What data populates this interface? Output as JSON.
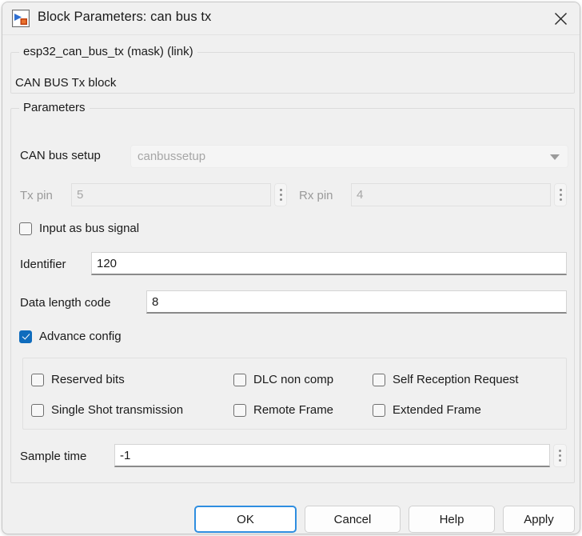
{
  "window": {
    "title": "Block Parameters: can bus tx",
    "icon": "simulink-block-icon",
    "close_label": "✕"
  },
  "mask_group": {
    "legend": "esp32_can_bus_tx (mask) (link)",
    "description": "CAN BUS Tx block"
  },
  "parameters_group": {
    "legend": "Parameters",
    "can_bus_setup": {
      "label": "CAN bus setup",
      "value": "canbussetup",
      "enabled": false
    },
    "tx_pin": {
      "label": "Tx pin",
      "value": "5",
      "enabled": false
    },
    "rx_pin": {
      "label": "Rx pin",
      "value": "4",
      "enabled": false
    },
    "input_as_bus_signal": {
      "label": "Input as bus signal",
      "checked": false
    },
    "identifier": {
      "label": "Identifier",
      "value": "120"
    },
    "data_length_code": {
      "label": "Data length code",
      "value": "8"
    },
    "advance_config": {
      "label": "Advance config",
      "checked": true
    },
    "advance_options": [
      {
        "label": "Reserved bits",
        "checked": false
      },
      {
        "label": "DLC non comp",
        "checked": false
      },
      {
        "label": "Self Reception Request",
        "checked": false
      },
      {
        "label": "Single Shot transmission",
        "checked": false
      },
      {
        "label": "Remote Frame",
        "checked": false
      },
      {
        "label": "Extended Frame",
        "checked": false
      }
    ],
    "sample_time": {
      "label": "Sample time",
      "value": "-1"
    }
  },
  "footer": {
    "ok": "OK",
    "cancel": "Cancel",
    "help": "Help",
    "apply": "Apply"
  },
  "colors": {
    "accent": "#0f6cbd",
    "focus_border": "#2f8ee0",
    "background": "#f0f0f0",
    "text": "#1a1a1a",
    "disabled_text": "#a6a6a6"
  }
}
